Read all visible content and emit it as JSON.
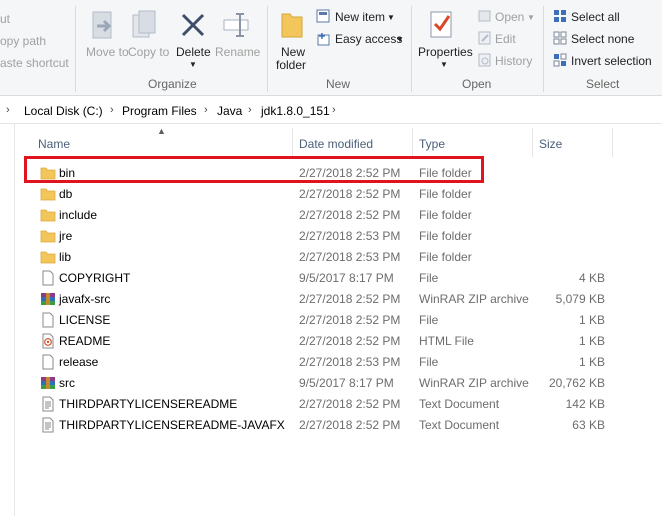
{
  "ribbon": {
    "clipboard": {
      "copy_path": "opy path",
      "paste_shortcut": "aste shortcut",
      "cut": "ut"
    },
    "organize": {
      "move_to": "Move to",
      "copy_to": "Copy to",
      "delete": "Delete",
      "rename": "Rename",
      "label": "Organize"
    },
    "new": {
      "new_folder_line1": "New",
      "new_folder_line2": "folder",
      "new_item": "New item",
      "easy_access": "Easy access",
      "label": "New"
    },
    "open": {
      "properties": "Properties",
      "open": "Open",
      "edit": "Edit",
      "history": "History",
      "label": "Open"
    },
    "select": {
      "select_all": "Select all",
      "select_none": "Select none",
      "invert_selection": "Invert selection",
      "label": "Select"
    }
  },
  "address": {
    "crumbs": [
      "Local Disk (C:)",
      "Program Files",
      "Java",
      "jdk1.8.0_151"
    ]
  },
  "columns": {
    "name": "Name",
    "date": "Date modified",
    "type": "Type",
    "size": "Size"
  },
  "files": [
    {
      "name": "bin",
      "date": "2/27/2018 2:52 PM",
      "type": "File folder",
      "size": "",
      "icon": "folder-icon"
    },
    {
      "name": "db",
      "date": "2/27/2018 2:52 PM",
      "type": "File folder",
      "size": "",
      "icon": "folder-icon"
    },
    {
      "name": "include",
      "date": "2/27/2018 2:52 PM",
      "type": "File folder",
      "size": "",
      "icon": "folder-icon"
    },
    {
      "name": "jre",
      "date": "2/27/2018 2:53 PM",
      "type": "File folder",
      "size": "",
      "icon": "folder-icon"
    },
    {
      "name": "lib",
      "date": "2/27/2018 2:53 PM",
      "type": "File folder",
      "size": "",
      "icon": "folder-icon"
    },
    {
      "name": "COPYRIGHT",
      "date": "9/5/2017 8:17 PM",
      "type": "File",
      "size": "4 KB",
      "icon": "file-icon"
    },
    {
      "name": "javafx-src",
      "date": "2/27/2018 2:52 PM",
      "type": "WinRAR ZIP archive",
      "size": "5,079 KB",
      "icon": "winrar-icon"
    },
    {
      "name": "LICENSE",
      "date": "2/27/2018 2:52 PM",
      "type": "File",
      "size": "1 KB",
      "icon": "file-icon"
    },
    {
      "name": "README",
      "date": "2/27/2018 2:52 PM",
      "type": "HTML File",
      "size": "1 KB",
      "icon": "html-file-icon"
    },
    {
      "name": "release",
      "date": "2/27/2018 2:53 PM",
      "type": "File",
      "size": "1 KB",
      "icon": "file-icon"
    },
    {
      "name": "src",
      "date": "9/5/2017 8:17 PM",
      "type": "WinRAR ZIP archive",
      "size": "20,762 KB",
      "icon": "winrar-icon"
    },
    {
      "name": "THIRDPARTYLICENSEREADME",
      "date": "2/27/2018 2:52 PM",
      "type": "Text Document",
      "size": "142 KB",
      "icon": "text-document-icon"
    },
    {
      "name": "THIRDPARTYLICENSEREADME-JAVAFX",
      "date": "2/27/2018 2:52 PM",
      "type": "Text Document",
      "size": "63 KB",
      "icon": "text-document-icon"
    }
  ],
  "colors": {
    "highlight": "#e0141e",
    "folder": "#f3c65b",
    "header_text": "#4c607a"
  }
}
